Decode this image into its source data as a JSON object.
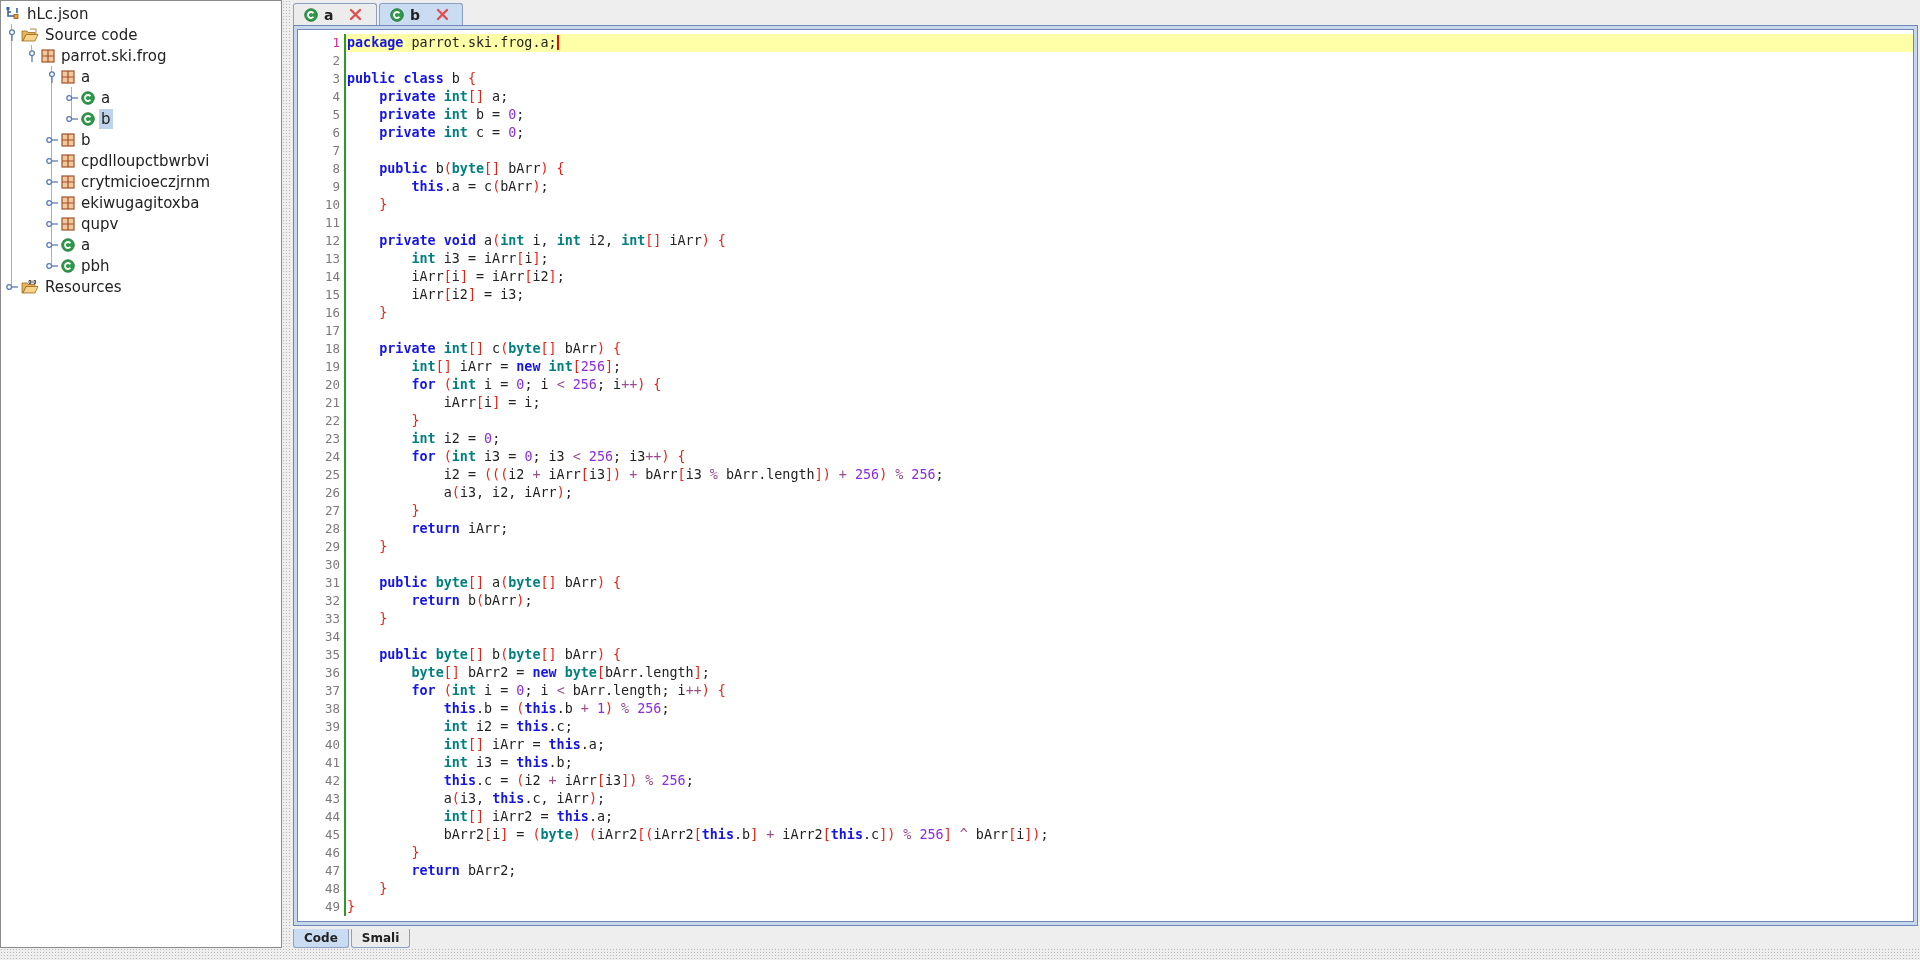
{
  "tree": {
    "label": "hLc.json",
    "kind": "project",
    "selected": false,
    "children": [
      {
        "label": "Source code",
        "kind": "source-folder",
        "expanded": true,
        "selected": false,
        "children": [
          {
            "label": "parrot.ski.frog",
            "kind": "package",
            "expanded": true,
            "selected": false,
            "children": [
              {
                "label": "a",
                "kind": "package",
                "expanded": true,
                "selected": false,
                "children": [
                  {
                    "label": "a",
                    "kind": "class",
                    "expanded": false,
                    "selected": false
                  },
                  {
                    "label": "b",
                    "kind": "class",
                    "expanded": false,
                    "selected": true
                  }
                ]
              },
              {
                "label": "b",
                "kind": "package",
                "expanded": false,
                "selected": false
              },
              {
                "label": "cpdlloupctbwrbvi",
                "kind": "package",
                "expanded": false,
                "selected": false
              },
              {
                "label": "crytmicioeczjrnm",
                "kind": "package",
                "expanded": false,
                "selected": false
              },
              {
                "label": "ekiwugagitoxba",
                "kind": "package",
                "expanded": false,
                "selected": false
              },
              {
                "label": "qupv",
                "kind": "package",
                "expanded": false,
                "selected": false
              },
              {
                "label": "a",
                "kind": "class",
                "expanded": false,
                "selected": false
              },
              {
                "label": "pbh",
                "kind": "class",
                "expanded": false,
                "selected": false
              }
            ]
          }
        ]
      },
      {
        "label": "Resources",
        "kind": "resources-folder",
        "expanded": false,
        "selected": false
      }
    ]
  },
  "tabs": [
    {
      "label": "a",
      "selected": false
    },
    {
      "label": "b",
      "selected": true
    }
  ],
  "editor": {
    "lines": [
      {
        "number": "1",
        "current": true,
        "segs": [
          {
            "kind": "keyword",
            "text": "package"
          },
          {
            "text": " parrot.ski.frog.a;"
          }
        ]
      },
      {
        "number": "2",
        "current": false
      },
      {
        "number": "3",
        "current": false,
        "segs": [
          {
            "kind": "keyword",
            "text": "public"
          },
          {
            "kind": "keyword",
            "text": " class"
          },
          {
            "text": " b "
          },
          {
            "kind": "bracket",
            "text": "{"
          }
        ]
      },
      {
        "number": "4",
        "current": false,
        "segs": [
          {
            "kind": "keyword",
            "text": "    private"
          },
          {
            "kind": "type",
            "text": " int"
          },
          {
            "kind": "bracket",
            "text": "[]"
          },
          {
            "text": " a;"
          }
        ]
      },
      {
        "number": "5",
        "current": false,
        "segs": [
          {
            "kind": "keyword",
            "text": "    private"
          },
          {
            "kind": "type",
            "text": " int"
          },
          {
            "text": " b = "
          },
          {
            "kind": "number",
            "text": "0"
          },
          {
            "text": ";"
          }
        ]
      },
      {
        "number": "6",
        "current": false,
        "segs": [
          {
            "kind": "keyword",
            "text": "    private"
          },
          {
            "kind": "type",
            "text": " int"
          },
          {
            "text": " c = "
          },
          {
            "kind": "number",
            "text": "0"
          },
          {
            "text": ";"
          }
        ]
      },
      {
        "number": "7",
        "current": false
      },
      {
        "number": "8",
        "current": false,
        "segs": [
          {
            "kind": "keyword",
            "text": "    public"
          },
          {
            "text": " b"
          },
          {
            "kind": "bracket",
            "text": "("
          },
          {
            "kind": "type",
            "text": "byte"
          },
          {
            "kind": "bracket",
            "text": "[]"
          },
          {
            "text": " bArr"
          },
          {
            "kind": "bracket",
            "text": ")"
          },
          {
            "kind": "bracket",
            "text": " {"
          }
        ]
      },
      {
        "number": "9",
        "current": false,
        "segs": [
          {
            "kind": "keyword",
            "text": "        this"
          },
          {
            "text": ".a = c"
          },
          {
            "kind": "bracket",
            "text": "("
          },
          {
            "text": "bArr"
          },
          {
            "kind": "bracket",
            "text": ")"
          },
          {
            "text": ";"
          }
        ]
      },
      {
        "number": "10",
        "current": false,
        "segs": [
          {
            "kind": "bracket",
            "text": "    }"
          }
        ]
      },
      {
        "number": "11",
        "current": false
      },
      {
        "number": "12",
        "current": false,
        "segs": [
          {
            "kind": "keyword",
            "text": "    private"
          },
          {
            "kind": "keyword",
            "text": " void"
          },
          {
            "text": " a"
          },
          {
            "kind": "bracket",
            "text": "("
          },
          {
            "kind": "type",
            "text": "int"
          },
          {
            "text": " i, "
          },
          {
            "kind": "type",
            "text": "int"
          },
          {
            "text": " i2, "
          },
          {
            "kind": "type",
            "text": "int"
          },
          {
            "kind": "bracket",
            "text": "[]"
          },
          {
            "text": " iArr"
          },
          {
            "kind": "bracket",
            "text": ")"
          },
          {
            "kind": "bracket",
            "text": " {"
          }
        ]
      },
      {
        "number": "13",
        "current": false,
        "segs": [
          {
            "kind": "type",
            "text": "        int"
          },
          {
            "text": " i3 = iArr"
          },
          {
            "kind": "bracket",
            "text": "["
          },
          {
            "text": "i"
          },
          {
            "kind": "bracket",
            "text": "]"
          },
          {
            "text": ";"
          }
        ]
      },
      {
        "number": "14",
        "current": false,
        "segs": [
          {
            "text": "        iArr"
          },
          {
            "kind": "bracket",
            "text": "["
          },
          {
            "text": "i"
          },
          {
            "kind": "bracket",
            "text": "]"
          },
          {
            "text": " = iArr"
          },
          {
            "kind": "bracket",
            "text": "["
          },
          {
            "text": "i2"
          },
          {
            "kind": "bracket",
            "text": "]"
          },
          {
            "text": ";"
          }
        ]
      },
      {
        "number": "15",
        "current": false,
        "segs": [
          {
            "text": "        iArr"
          },
          {
            "kind": "bracket",
            "text": "["
          },
          {
            "text": "i2"
          },
          {
            "kind": "bracket",
            "text": "]"
          },
          {
            "text": " = i3;"
          }
        ]
      },
      {
        "number": "16",
        "current": false,
        "segs": [
          {
            "kind": "bracket",
            "text": "    }"
          }
        ]
      },
      {
        "number": "17",
        "current": false
      },
      {
        "number": "18",
        "current": false,
        "segs": [
          {
            "kind": "keyword",
            "text": "    private"
          },
          {
            "kind": "type",
            "text": " int"
          },
          {
            "kind": "bracket",
            "text": "[]"
          },
          {
            "text": " c"
          },
          {
            "kind": "bracket",
            "text": "("
          },
          {
            "kind": "type",
            "text": "byte"
          },
          {
            "kind": "bracket",
            "text": "[]"
          },
          {
            "text": " bArr"
          },
          {
            "kind": "bracket",
            "text": ")"
          },
          {
            "kind": "bracket",
            "text": " {"
          }
        ]
      },
      {
        "number": "19",
        "current": false,
        "segs": [
          {
            "kind": "type",
            "text": "        int"
          },
          {
            "kind": "bracket",
            "text": "[]"
          },
          {
            "text": " iArr = "
          },
          {
            "kind": "keyword",
            "text": "new"
          },
          {
            "kind": "type",
            "text": " int"
          },
          {
            "kind": "bracket",
            "text": "["
          },
          {
            "kind": "number",
            "text": "256"
          },
          {
            "kind": "bracket",
            "text": "]"
          },
          {
            "text": ";"
          }
        ]
      },
      {
        "number": "20",
        "current": false,
        "segs": [
          {
            "kind": "keyword",
            "text": "        for"
          },
          {
            "kind": "bracket",
            "text": " ("
          },
          {
            "kind": "type",
            "text": "int"
          },
          {
            "text": " i = "
          },
          {
            "kind": "number",
            "text": "0"
          },
          {
            "text": "; i "
          },
          {
            "kind": "operator",
            "text": "<"
          },
          {
            "kind": "number",
            "text": " 256"
          },
          {
            "text": "; i"
          },
          {
            "kind": "operator",
            "text": "++"
          },
          {
            "kind": "bracket",
            "text": ")"
          },
          {
            "kind": "bracket",
            "text": " {"
          }
        ]
      },
      {
        "number": "21",
        "current": false,
        "segs": [
          {
            "text": "            iArr"
          },
          {
            "kind": "bracket",
            "text": "["
          },
          {
            "text": "i"
          },
          {
            "kind": "bracket",
            "text": "]"
          },
          {
            "text": " = i;"
          }
        ]
      },
      {
        "number": "22",
        "current": false,
        "segs": [
          {
            "kind": "bracket",
            "text": "        }"
          }
        ]
      },
      {
        "number": "23",
        "current": false,
        "segs": [
          {
            "kind": "type",
            "text": "        int"
          },
          {
            "text": " i2 = "
          },
          {
            "kind": "number",
            "text": "0"
          },
          {
            "text": ";"
          }
        ]
      },
      {
        "number": "24",
        "current": false,
        "segs": [
          {
            "kind": "keyword",
            "text": "        for"
          },
          {
            "kind": "bracket",
            "text": " ("
          },
          {
            "kind": "type",
            "text": "int"
          },
          {
            "text": " i3 = "
          },
          {
            "kind": "number",
            "text": "0"
          },
          {
            "text": "; i3 "
          },
          {
            "kind": "operator",
            "text": "<"
          },
          {
            "kind": "number",
            "text": " 256"
          },
          {
            "text": "; i3"
          },
          {
            "kind": "operator",
            "text": "++"
          },
          {
            "kind": "bracket",
            "text": ")"
          },
          {
            "kind": "bracket",
            "text": " {"
          }
        ]
      },
      {
        "number": "25",
        "current": false,
        "segs": [
          {
            "text": "            i2 = "
          },
          {
            "kind": "bracket",
            "text": "((("
          },
          {
            "text": "i2 "
          },
          {
            "kind": "operator",
            "text": "+"
          },
          {
            "text": " iArr"
          },
          {
            "kind": "bracket",
            "text": "["
          },
          {
            "text": "i3"
          },
          {
            "kind": "bracket",
            "text": "])"
          },
          {
            "kind": "operator",
            "text": " +"
          },
          {
            "text": " bArr"
          },
          {
            "kind": "bracket",
            "text": "["
          },
          {
            "text": "i3 "
          },
          {
            "kind": "operator",
            "text": "%"
          },
          {
            "text": " bArr.length"
          },
          {
            "kind": "bracket",
            "text": "])"
          },
          {
            "kind": "operator",
            "text": " +"
          },
          {
            "kind": "number",
            "text": " 256"
          },
          {
            "kind": "bracket",
            "text": ")"
          },
          {
            "kind": "operator",
            "text": " %"
          },
          {
            "kind": "number",
            "text": " 256"
          },
          {
            "text": ";"
          }
        ]
      },
      {
        "number": "26",
        "current": false,
        "segs": [
          {
            "text": "            a"
          },
          {
            "kind": "bracket",
            "text": "("
          },
          {
            "text": "i3, i2, iArr"
          },
          {
            "kind": "bracket",
            "text": ")"
          },
          {
            "text": ";"
          }
        ]
      },
      {
        "number": "27",
        "current": false,
        "segs": [
          {
            "kind": "bracket",
            "text": "        }"
          }
        ]
      },
      {
        "number": "28",
        "current": false,
        "segs": [
          {
            "kind": "keyword",
            "text": "        return"
          },
          {
            "text": " iArr;"
          }
        ]
      },
      {
        "number": "29",
        "current": false,
        "segs": [
          {
            "kind": "bracket",
            "text": "    }"
          }
        ]
      },
      {
        "number": "30",
        "current": false
      },
      {
        "number": "31",
        "current": false,
        "segs": [
          {
            "kind": "keyword",
            "text": "    public"
          },
          {
            "kind": "type",
            "text": " byte"
          },
          {
            "kind": "bracket",
            "text": "[]"
          },
          {
            "text": " a"
          },
          {
            "kind": "bracket",
            "text": "("
          },
          {
            "kind": "type",
            "text": "byte"
          },
          {
            "kind": "bracket",
            "text": "[]"
          },
          {
            "text": " bArr"
          },
          {
            "kind": "bracket",
            "text": ")"
          },
          {
            "kind": "bracket",
            "text": " {"
          }
        ]
      },
      {
        "number": "32",
        "current": false,
        "segs": [
          {
            "kind": "keyword",
            "text": "        return"
          },
          {
            "text": " b"
          },
          {
            "kind": "bracket",
            "text": "("
          },
          {
            "text": "bArr"
          },
          {
            "kind": "bracket",
            "text": ")"
          },
          {
            "text": ";"
          }
        ]
      },
      {
        "number": "33",
        "current": false,
        "segs": [
          {
            "kind": "bracket",
            "text": "    }"
          }
        ]
      },
      {
        "number": "34",
        "current": false
      },
      {
        "number": "35",
        "current": false,
        "segs": [
          {
            "kind": "keyword",
            "text": "    public"
          },
          {
            "kind": "type",
            "text": " byte"
          },
          {
            "kind": "bracket",
            "text": "[]"
          },
          {
            "text": " b"
          },
          {
            "kind": "bracket",
            "text": "("
          },
          {
            "kind": "type",
            "text": "byte"
          },
          {
            "kind": "bracket",
            "text": "[]"
          },
          {
            "text": " bArr"
          },
          {
            "kind": "bracket",
            "text": ")"
          },
          {
            "kind": "bracket",
            "text": " {"
          }
        ]
      },
      {
        "number": "36",
        "current": false,
        "segs": [
          {
            "kind": "type",
            "text": "        byte"
          },
          {
            "kind": "bracket",
            "text": "[]"
          },
          {
            "text": " bArr2 = "
          },
          {
            "kind": "keyword",
            "text": "new"
          },
          {
            "kind": "type",
            "text": " byte"
          },
          {
            "kind": "bracket",
            "text": "["
          },
          {
            "text": "bArr.length"
          },
          {
            "kind": "bracket",
            "text": "]"
          },
          {
            "text": ";"
          }
        ]
      },
      {
        "number": "37",
        "current": false,
        "segs": [
          {
            "kind": "keyword",
            "text": "        for"
          },
          {
            "kind": "bracket",
            "text": " ("
          },
          {
            "kind": "type",
            "text": "int"
          },
          {
            "text": " i = "
          },
          {
            "kind": "number",
            "text": "0"
          },
          {
            "text": "; i "
          },
          {
            "kind": "operator",
            "text": "<"
          },
          {
            "text": " bArr.length; i"
          },
          {
            "kind": "operator",
            "text": "++"
          },
          {
            "kind": "bracket",
            "text": ")"
          },
          {
            "kind": "bracket",
            "text": " {"
          }
        ]
      },
      {
        "number": "38",
        "current": false,
        "segs": [
          {
            "kind": "keyword",
            "text": "            this"
          },
          {
            "text": ".b = "
          },
          {
            "kind": "bracket",
            "text": "("
          },
          {
            "kind": "keyword",
            "text": "this"
          },
          {
            "text": ".b "
          },
          {
            "kind": "operator",
            "text": "+"
          },
          {
            "kind": "number",
            "text": " 1"
          },
          {
            "kind": "bracket",
            "text": ")"
          },
          {
            "kind": "operator",
            "text": " %"
          },
          {
            "kind": "number",
            "text": " 256"
          },
          {
            "text": ";"
          }
        ]
      },
      {
        "number": "39",
        "current": false,
        "segs": [
          {
            "kind": "type",
            "text": "            int"
          },
          {
            "text": " i2 = "
          },
          {
            "kind": "keyword",
            "text": "this"
          },
          {
            "text": ".c;"
          }
        ]
      },
      {
        "number": "40",
        "current": false,
        "segs": [
          {
            "kind": "type",
            "text": "            int"
          },
          {
            "kind": "bracket",
            "text": "[]"
          },
          {
            "text": " iArr = "
          },
          {
            "kind": "keyword",
            "text": "this"
          },
          {
            "text": ".a;"
          }
        ]
      },
      {
        "number": "41",
        "current": false,
        "segs": [
          {
            "kind": "type",
            "text": "            int"
          },
          {
            "text": " i3 = "
          },
          {
            "kind": "keyword",
            "text": "this"
          },
          {
            "text": ".b;"
          }
        ]
      },
      {
        "number": "42",
        "current": false,
        "segs": [
          {
            "kind": "keyword",
            "text": "            this"
          },
          {
            "text": ".c = "
          },
          {
            "kind": "bracket",
            "text": "("
          },
          {
            "text": "i2 "
          },
          {
            "kind": "operator",
            "text": "+"
          },
          {
            "text": " iArr"
          },
          {
            "kind": "bracket",
            "text": "["
          },
          {
            "text": "i3"
          },
          {
            "kind": "bracket",
            "text": "])"
          },
          {
            "kind": "operator",
            "text": " %"
          },
          {
            "kind": "number",
            "text": " 256"
          },
          {
            "text": ";"
          }
        ]
      },
      {
        "number": "43",
        "current": false,
        "segs": [
          {
            "text": "            a"
          },
          {
            "kind": "bracket",
            "text": "("
          },
          {
            "text": "i3, "
          },
          {
            "kind": "keyword",
            "text": "this"
          },
          {
            "text": ".c, iArr"
          },
          {
            "kind": "bracket",
            "text": ")"
          },
          {
            "text": ";"
          }
        ]
      },
      {
        "number": "44",
        "current": false,
        "segs": [
          {
            "kind": "type",
            "text": "            int"
          },
          {
            "kind": "bracket",
            "text": "[]"
          },
          {
            "text": " iArr2 = "
          },
          {
            "kind": "keyword",
            "text": "this"
          },
          {
            "text": ".a;"
          }
        ]
      },
      {
        "number": "45",
        "current": false,
        "segs": [
          {
            "text": "            bArr2"
          },
          {
            "kind": "bracket",
            "text": "["
          },
          {
            "text": "i"
          },
          {
            "kind": "bracket",
            "text": "]"
          },
          {
            "text": " = "
          },
          {
            "kind": "bracket",
            "text": "("
          },
          {
            "kind": "type",
            "text": "byte"
          },
          {
            "kind": "bracket",
            "text": ")"
          },
          {
            "kind": "bracket",
            "text": " ("
          },
          {
            "text": "iArr2"
          },
          {
            "kind": "bracket",
            "text": "[("
          },
          {
            "text": "iArr2"
          },
          {
            "kind": "bracket",
            "text": "["
          },
          {
            "kind": "keyword",
            "text": "this"
          },
          {
            "text": ".b"
          },
          {
            "kind": "bracket",
            "text": "]"
          },
          {
            "kind": "operator",
            "text": " +"
          },
          {
            "text": " iArr2"
          },
          {
            "kind": "bracket",
            "text": "["
          },
          {
            "kind": "keyword",
            "text": "this"
          },
          {
            "text": ".c"
          },
          {
            "kind": "bracket",
            "text": "])"
          },
          {
            "kind": "operator",
            "text": " %"
          },
          {
            "kind": "number",
            "text": " 256"
          },
          {
            "kind": "bracket",
            "text": "]"
          },
          {
            "kind": "operator",
            "text": " ^"
          },
          {
            "text": " bArr"
          },
          {
            "kind": "bracket",
            "text": "["
          },
          {
            "text": "i"
          },
          {
            "kind": "bracket",
            "text": "])"
          },
          {
            "text": ";"
          }
        ]
      },
      {
        "number": "46",
        "current": false,
        "segs": [
          {
            "kind": "bracket",
            "text": "        }"
          }
        ]
      },
      {
        "number": "47",
        "current": false,
        "segs": [
          {
            "kind": "keyword",
            "text": "        return"
          },
          {
            "text": " bArr2;"
          }
        ]
      },
      {
        "number": "48",
        "current": false,
        "segs": [
          {
            "kind": "bracket",
            "text": "    }"
          }
        ]
      },
      {
        "number": "49",
        "current": false,
        "segs": [
          {
            "kind": "bracket",
            "text": "}"
          }
        ]
      }
    ]
  },
  "view_tabs": [
    {
      "label": "Code",
      "selected": true
    },
    {
      "label": "Smali",
      "selected": false
    }
  ]
}
